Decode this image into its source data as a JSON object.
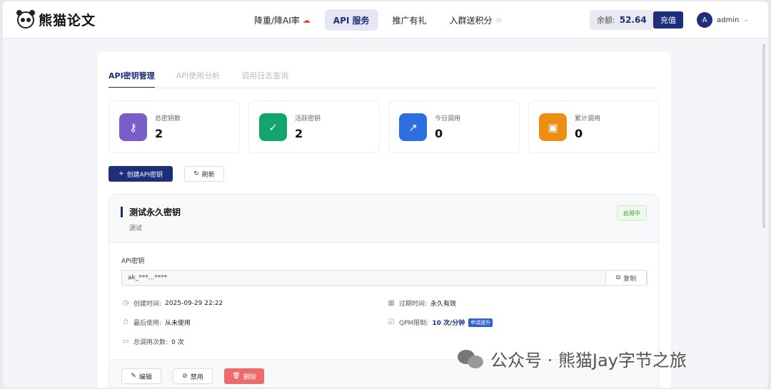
{
  "brand": {
    "name": "熊猫论文",
    "icon": "panda-logo-icon"
  },
  "nav": [
    {
      "label": "降重/降AI率",
      "icon": "cloud-upload-icon",
      "active": false
    },
    {
      "label": "API 服务",
      "icon": "",
      "active": true
    },
    {
      "label": "推广有礼",
      "icon": "",
      "active": false
    },
    {
      "label": "入群送积分",
      "icon": "star-icon",
      "active": false
    }
  ],
  "account": {
    "balance_label": "余额:",
    "balance_value": "52.64",
    "recharge_label": "充值",
    "avatar_letter": "A",
    "username": "admin"
  },
  "tabs": [
    {
      "label": "API密钥管理",
      "active": true
    },
    {
      "label": "API使用分析",
      "active": false
    },
    {
      "label": "调用日志查询",
      "active": false
    }
  ],
  "stats": [
    {
      "label": "总密钥数",
      "value": "2",
      "icon": "key-icon",
      "color": "#7a5ec8"
    },
    {
      "label": "活跃密钥",
      "value": "2",
      "icon": "check-list-icon",
      "color": "#14a56f"
    },
    {
      "label": "今日调用",
      "value": "0",
      "icon": "trend-chart-icon",
      "color": "#2f6ee0"
    },
    {
      "label": "累计调用",
      "value": "0",
      "icon": "presentation-icon",
      "color": "#ef8c12"
    }
  ],
  "actions": {
    "create_label": "创建API密钥",
    "refresh_label": "刷新"
  },
  "key": {
    "title": "测试永久密钥",
    "description": "测试",
    "status": "启用中",
    "api_key_label": "API密钥",
    "api_key_value": "ak_***...****",
    "copy_label": "复制",
    "created_label": "创建时间:",
    "created_value": "2025-09-29 22:22",
    "expire_label": "过期时间:",
    "expire_value": "永久有效",
    "last_used_label": "最后使用:",
    "last_used_value": "从未使用",
    "qpm_label": "QPM限制:",
    "qpm_value": "10 次/分钟",
    "upgrade_label": "申请提升",
    "total_calls_label": "总调用次数:",
    "total_calls_value": "0 次",
    "edit_label": "编辑",
    "disable_label": "禁用",
    "delete_label": "删除"
  },
  "watermark": "公众号 · 熊猫Jay字节之旅"
}
